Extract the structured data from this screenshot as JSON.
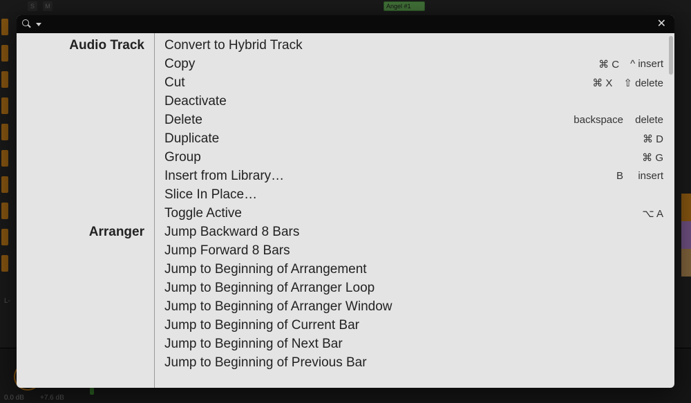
{
  "background": {
    "solo_label": "S",
    "mute_label": "M",
    "clip_name": "Angel #1",
    "level_label": "L-",
    "volume_db": "0.0 dB",
    "peak_db": "+7.6 dB"
  },
  "palette": {
    "search_placeholder": "",
    "close_glyph": "✕",
    "categories": [
      {
        "label": "Audio Track",
        "start_index": 0
      },
      {
        "label": "Arranger",
        "start_index": 10
      }
    ],
    "commands": [
      {
        "label": "Convert to Hybrid Track",
        "shortcut1": "",
        "shortcut2": ""
      },
      {
        "label": "Copy",
        "shortcut1": "⌘ C",
        "shortcut2": "^ insert"
      },
      {
        "label": "Cut",
        "shortcut1": "⌘ X",
        "shortcut2": "⇧ delete"
      },
      {
        "label": "Deactivate",
        "shortcut1": "",
        "shortcut2": ""
      },
      {
        "label": "Delete",
        "shortcut1": "backspace",
        "shortcut2": "delete"
      },
      {
        "label": "Duplicate",
        "shortcut1": "",
        "shortcut2": "⌘ D"
      },
      {
        "label": "Group",
        "shortcut1": "",
        "shortcut2": "⌘ G"
      },
      {
        "label": "Insert from Library…",
        "shortcut1": "B",
        "shortcut2": "insert"
      },
      {
        "label": "Slice In Place…",
        "shortcut1": "",
        "shortcut2": ""
      },
      {
        "label": "Toggle Active",
        "shortcut1": "",
        "shortcut2": "⌥ A"
      },
      {
        "label": "Jump Backward 8 Bars",
        "shortcut1": "",
        "shortcut2": ""
      },
      {
        "label": "Jump Forward 8 Bars",
        "shortcut1": "",
        "shortcut2": ""
      },
      {
        "label": "Jump to Beginning of Arrangement",
        "shortcut1": "",
        "shortcut2": ""
      },
      {
        "label": "Jump to Beginning of Arranger Loop",
        "shortcut1": "",
        "shortcut2": ""
      },
      {
        "label": "Jump to Beginning of Arranger Window",
        "shortcut1": "",
        "shortcut2": ""
      },
      {
        "label": "Jump to Beginning of Current Bar",
        "shortcut1": "",
        "shortcut2": ""
      },
      {
        "label": "Jump to Beginning of Next Bar",
        "shortcut1": "",
        "shortcut2": ""
      },
      {
        "label": "Jump to Beginning of Previous Bar",
        "shortcut1": "",
        "shortcut2": ""
      }
    ]
  }
}
